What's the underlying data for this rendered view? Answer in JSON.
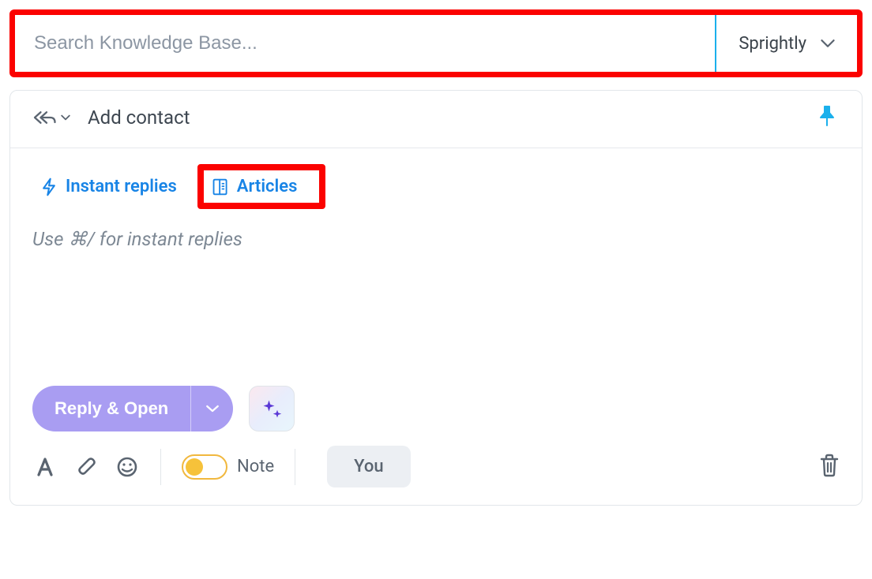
{
  "search": {
    "placeholder": "Search Knowledge Base...",
    "value": "",
    "selected_kb": "Sprightly"
  },
  "header": {
    "add_contact_label": "Add contact"
  },
  "tabs": {
    "instant_replies": "Instant replies",
    "articles": "Articles"
  },
  "editor": {
    "placeholder": "Use ⌘/ for instant replies"
  },
  "actions": {
    "reply_open": "Reply & Open",
    "note_label": "Note",
    "you_label": "You"
  }
}
